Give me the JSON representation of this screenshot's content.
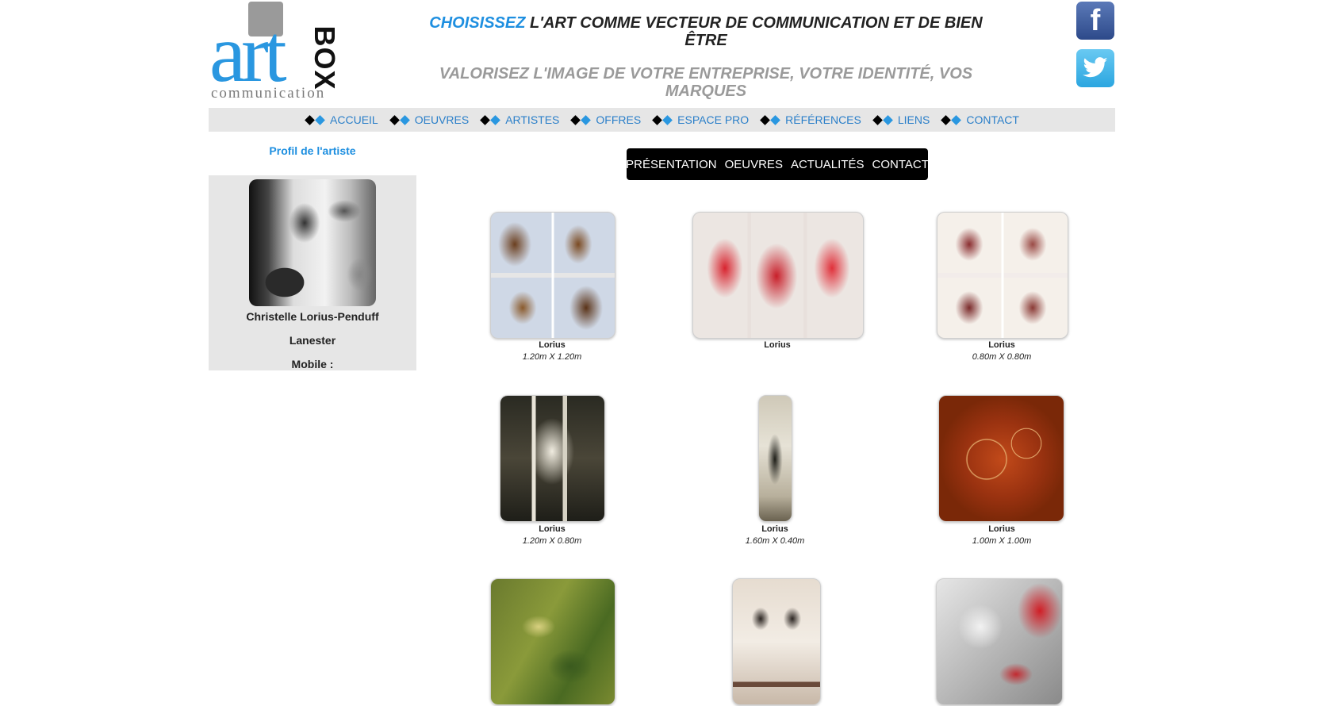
{
  "logo": {
    "art": "art",
    "box": "BOX",
    "sub": "communication"
  },
  "tagline": {
    "highlight": "CHOISISSEZ",
    "line1_rest": " L'ART COMME VECTEUR DE COMMUNICATION ET DE BIEN ÊTRE",
    "line2": "VALORISEZ L'IMAGE DE VOTRE ENTREPRISE, VOTRE IDENTITÉ, VOS MARQUES"
  },
  "social": {
    "facebook": "f"
  },
  "nav": [
    "ACCUEIL",
    "OEUVRES",
    "ARTISTES",
    "OFFRES",
    "ESPACE PRO",
    "RÉFÉRENCES",
    "LIENS",
    "CONTACT"
  ],
  "sidebar": {
    "title": "Profil de l'artiste",
    "name": "Christelle Lorius-Penduff",
    "city": "Lanester",
    "mobile": "Mobile :"
  },
  "subnav": [
    "PRÉSENTATION",
    "OEUVRES",
    "ACTUALITÉS",
    "CONTACT"
  ],
  "works": [
    {
      "title": "Lorius",
      "dims": "1.20m X 1.20m"
    },
    {
      "title": "Lorius",
      "dims": ""
    },
    {
      "title": "Lorius",
      "dims": "0.80m X 0.80m"
    },
    {
      "title": "Lorius",
      "dims": "1.20m X 0.80m"
    },
    {
      "title": "Lorius",
      "dims": "1.60m X 0.40m"
    },
    {
      "title": "Lorius",
      "dims": "1.00m X 1.00m"
    }
  ],
  "colors": {
    "accent": "#1e8fe0",
    "nav_bg": "#e6e6e6",
    "subnav_bg": "#000000"
  }
}
